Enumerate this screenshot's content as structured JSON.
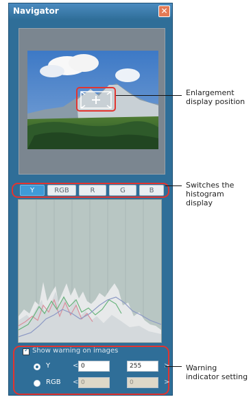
{
  "window": {
    "title": "Navigator",
    "close_icon": "close-icon"
  },
  "tabs": [
    {
      "label": "Y",
      "active": true
    },
    {
      "label": "RGB",
      "active": false
    },
    {
      "label": "R",
      "active": false
    },
    {
      "label": "G",
      "active": false
    },
    {
      "label": "B",
      "active": false
    }
  ],
  "warning": {
    "checkbox_checked": true,
    "checkbox_label": "Show warning on images",
    "y_option": {
      "label": "Y",
      "selected": true,
      "low_label": "<",
      "low_value": "0",
      "high_value": "255",
      "high_label": ">"
    },
    "rgb_option": {
      "label": "RGB",
      "selected": false,
      "low_label": "<",
      "low_value": "0",
      "high_value": "0",
      "high_label": ">"
    }
  },
  "annotations": {
    "enlargement": [
      "Enlargement",
      "display position"
    ],
    "histogram": [
      "Switches the",
      "histogram",
      "display"
    ],
    "warning": [
      "Warning",
      "indicator setting"
    ]
  },
  "colors": {
    "highlight_red": "#e3342f",
    "window_blue": "#2f6e98"
  }
}
